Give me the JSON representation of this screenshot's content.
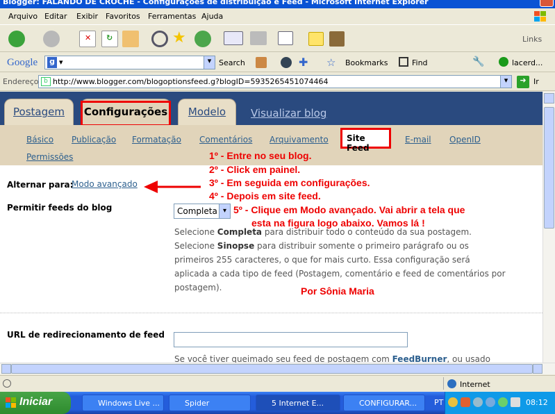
{
  "window": {
    "title": "Blogger: FALANDO DE CROCHÊ - Configurações de distribuição e Feed - Microsoft Internet Explorer"
  },
  "menubar": {
    "items": [
      "Arquivo",
      "Editar",
      "Exibir",
      "Favoritos",
      "Ferramentas",
      "Ajuda"
    ]
  },
  "toolbar": {
    "links_label": "Links"
  },
  "googlebar": {
    "logo": "Google",
    "search_label": "Search",
    "bookmarks_label": "Bookmarks",
    "find_label": "Find",
    "account_label": "lacerd..."
  },
  "addressbar": {
    "label": "Endereço",
    "url": "http://www.blogger.com/blogoptionsfeed.g?blogID=5935265451074464",
    "go_label": "Ir"
  },
  "blogger": {
    "tabs": {
      "postagem": "Postagem",
      "configuracoes": "Configurações",
      "modelo": "Modelo",
      "visualizar": "Visualizar blog"
    },
    "subnav": {
      "basico": "Básico",
      "publicacao": "Publicação",
      "formatacao": "Formatação",
      "comentarios": "Comentários",
      "arquivamento": "Arquivamento",
      "site_feed": "Site Feed",
      "email": "E-mail",
      "openid": "OpenID",
      "permissoes": "Permissões"
    },
    "alternar_label": "Alternar para:",
    "modo_avancado": "Modo avançado",
    "permitir_label": "Permitir feeds do blog",
    "select_value": "Completa",
    "desc_line1_a": "Selecione ",
    "desc_line1_b": "Completa",
    "desc_line1_c": " para distribuir todo o conteúdo da sua postagem.",
    "desc_line2_a": "Selecione ",
    "desc_line2_b": "Sinopse",
    "desc_line2_c": " para distribuir somente o primeiro parágrafo ou os",
    "desc_line3": "primeiros 255 caracteres, o que for mais curto. Essa configuração será",
    "desc_line4": "aplicada a cada tipo de feed (Postagem, comentário e feed de comentários por",
    "desc_line5": "postagem).",
    "url_label": "URL de redirecionamento de feed",
    "cut_text_a": "Se você tiver queimado seu feed de postagem com ",
    "cut_text_b": "FeedBurner",
    "cut_text_c": ", ou usado"
  },
  "annotations": {
    "step1": "1º - Entre no seu blog.",
    "step2": "2º - Click em painel.",
    "step3": "3º - Em seguida em configurações.",
    "step4": "4º - Depois em site feed.",
    "step5a": "5º - Clique em Modo avançado. Vai abrir a tela que",
    "step5b": "esta na figura logo abaixo. Vamos lá !",
    "author": "Por Sônia Maria"
  },
  "statusbar": {
    "zone": "Internet"
  },
  "taskbar": {
    "start": "Iniciar",
    "tasks": [
      "Windows Live ...",
      "Spider",
      "5 Internet E...",
      "CONFIGURAR..."
    ],
    "lang": "PT",
    "clock": "08:12"
  }
}
